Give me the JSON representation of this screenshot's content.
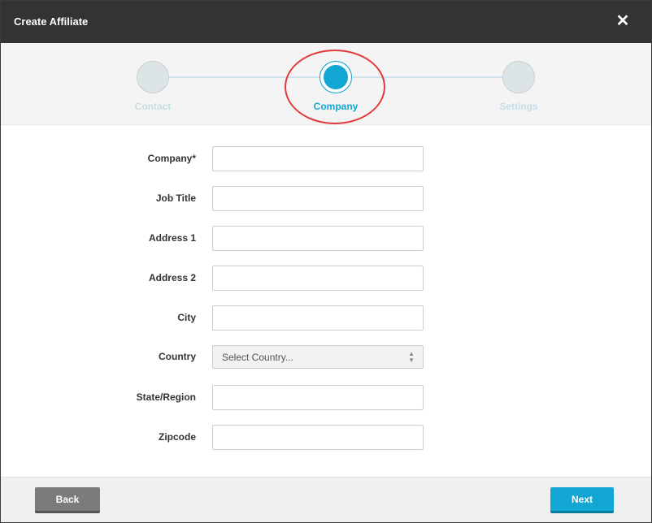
{
  "dialog": {
    "title": "Create Affiliate",
    "close_glyph": "✕"
  },
  "stepper": {
    "steps": [
      {
        "label": "Contact",
        "state": "inactive"
      },
      {
        "label": "Company",
        "state": "active"
      },
      {
        "label": "Settings",
        "state": "inactive"
      }
    ]
  },
  "form": {
    "company_label": "Company*",
    "company_value": "",
    "job_title_label": "Job Title",
    "job_title_value": "",
    "address1_label": "Address 1",
    "address1_value": "",
    "address2_label": "Address 2",
    "address2_value": "",
    "city_label": "City",
    "city_value": "",
    "country_label": "Country",
    "country_selected": "Select Country...",
    "state_label": "State/Region",
    "state_value": "",
    "zipcode_label": "Zipcode",
    "zipcode_value": ""
  },
  "footer": {
    "back_label": "Back",
    "next_label": "Next"
  },
  "colors": {
    "accent": "#12a6d3",
    "titlebar": "#333333",
    "annotation": "#e03a3a"
  }
}
